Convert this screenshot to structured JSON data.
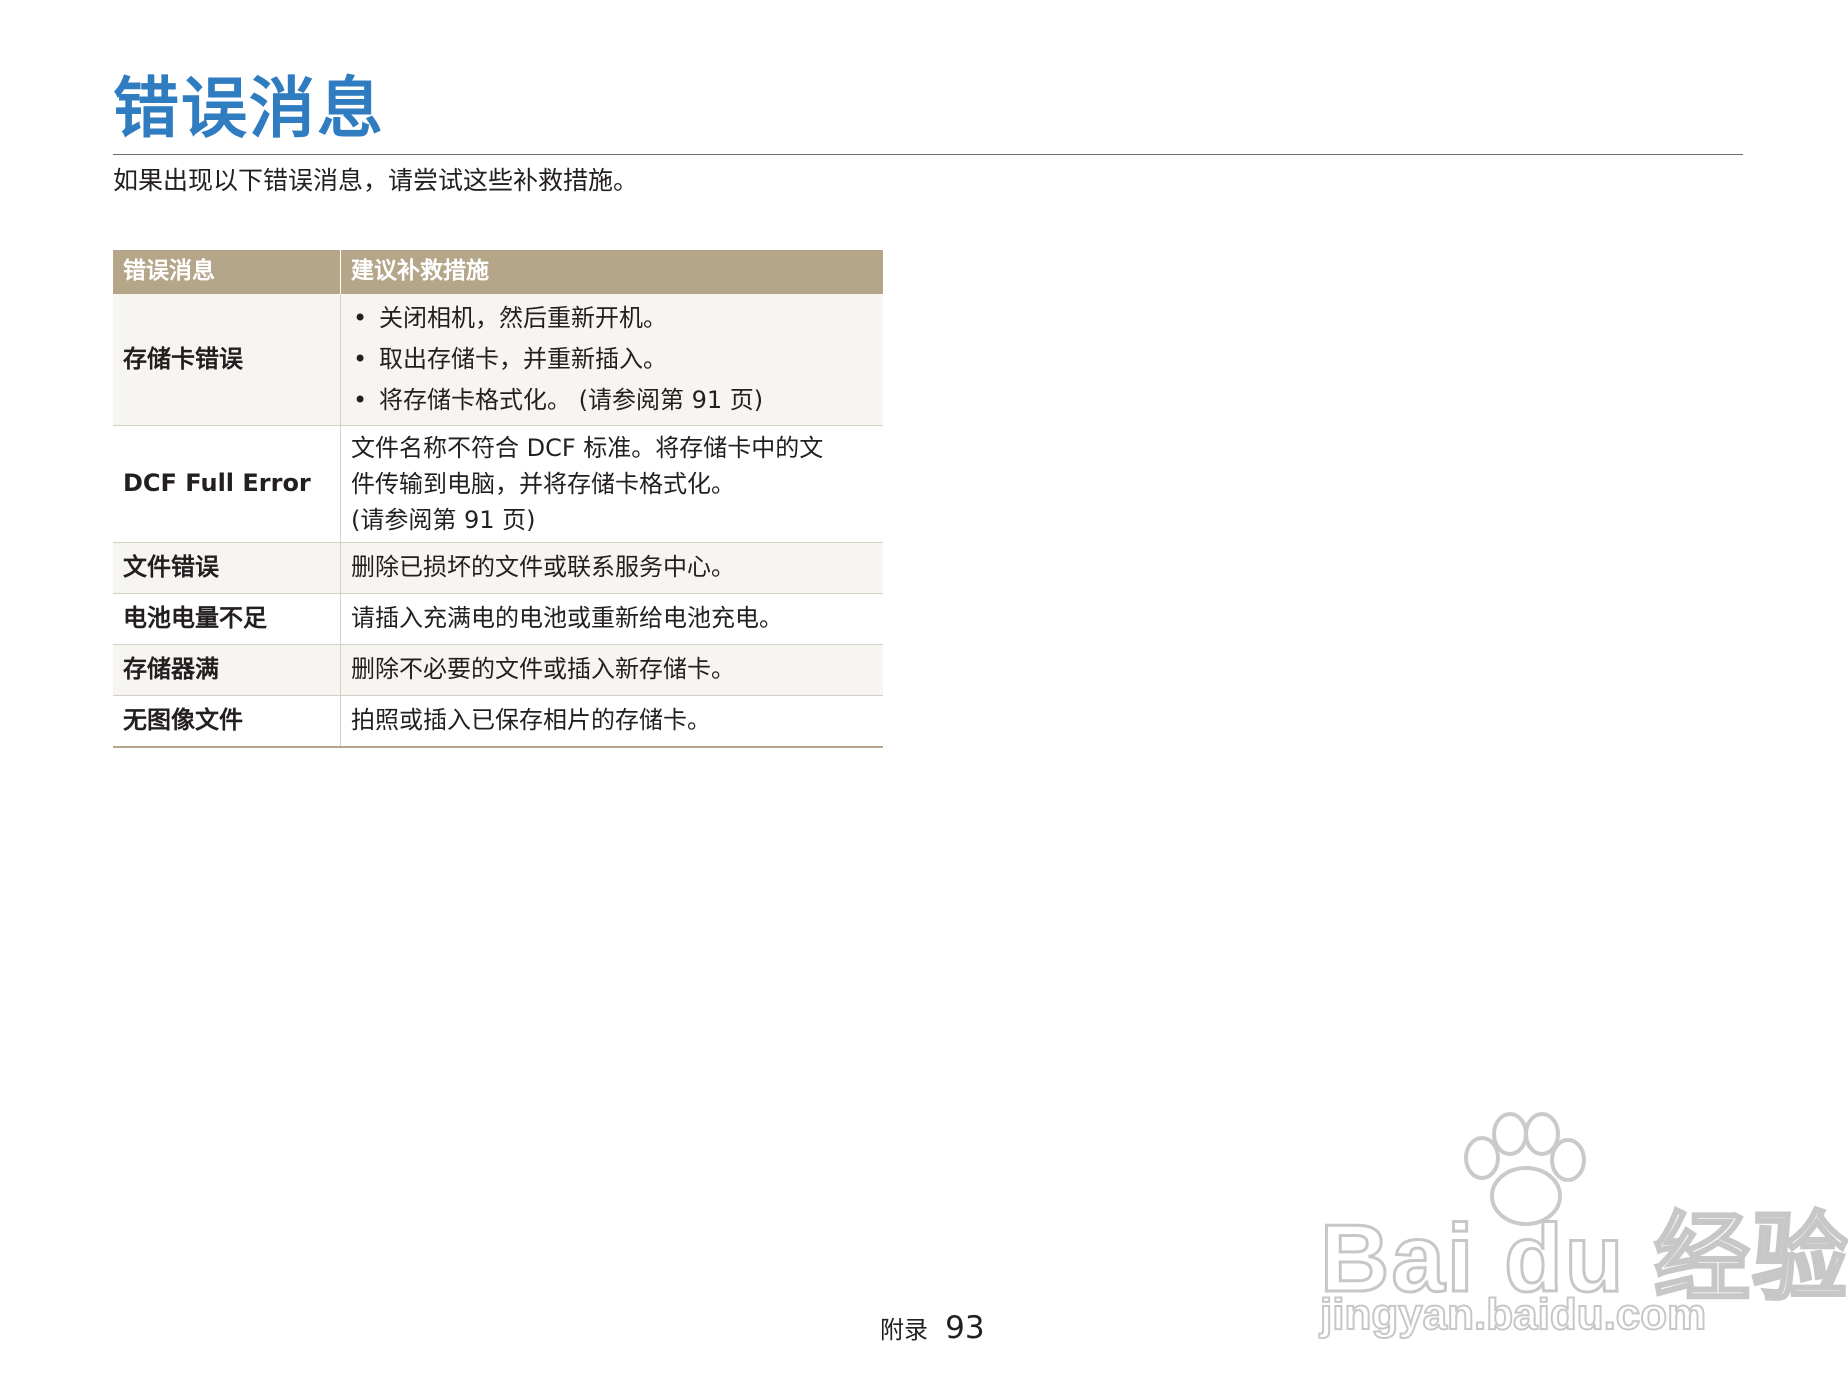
{
  "page": {
    "title": "错误消息",
    "intro": "如果出现以下错误消息，请尝试这些补救措施。"
  },
  "table": {
    "headers": [
      "错误消息",
      "建议补救措施"
    ],
    "rows": [
      {
        "name": "存储卡错误",
        "remedies": [
          "关闭相机，然后重新开机。",
          "取出存储卡，并重新插入。",
          "将存储卡格式化。 (请参阅第 91 页)"
        ]
      },
      {
        "name": "DCF Full Error",
        "remedy_lines": [
          "文件名称不符合 DCF 标准。将存储卡中的文",
          "件传输到电脑，并将存储卡格式化。",
          "(请参阅第 91 页)"
        ]
      },
      {
        "name": "文件错误",
        "remedy": "删除已损坏的文件或联系服务中心。"
      },
      {
        "name": "电池电量不足",
        "remedy": "请插入充满电的电池或重新给电池充电。"
      },
      {
        "name": "存储器满",
        "remedy": "删除不必要的文件或插入新存储卡。"
      },
      {
        "name": "无图像文件",
        "remedy": "拍照或插入已保存相片的存储卡。"
      }
    ]
  },
  "footer": {
    "section": "附录",
    "page_number": "93"
  },
  "watermark": {
    "logo": "Bai du 经验",
    "url": "jingyan.baidu.com"
  },
  "colors": {
    "title": "#2f7cc0",
    "header_bg": "#b5a68a",
    "row_shade": "#f6f5f1"
  }
}
